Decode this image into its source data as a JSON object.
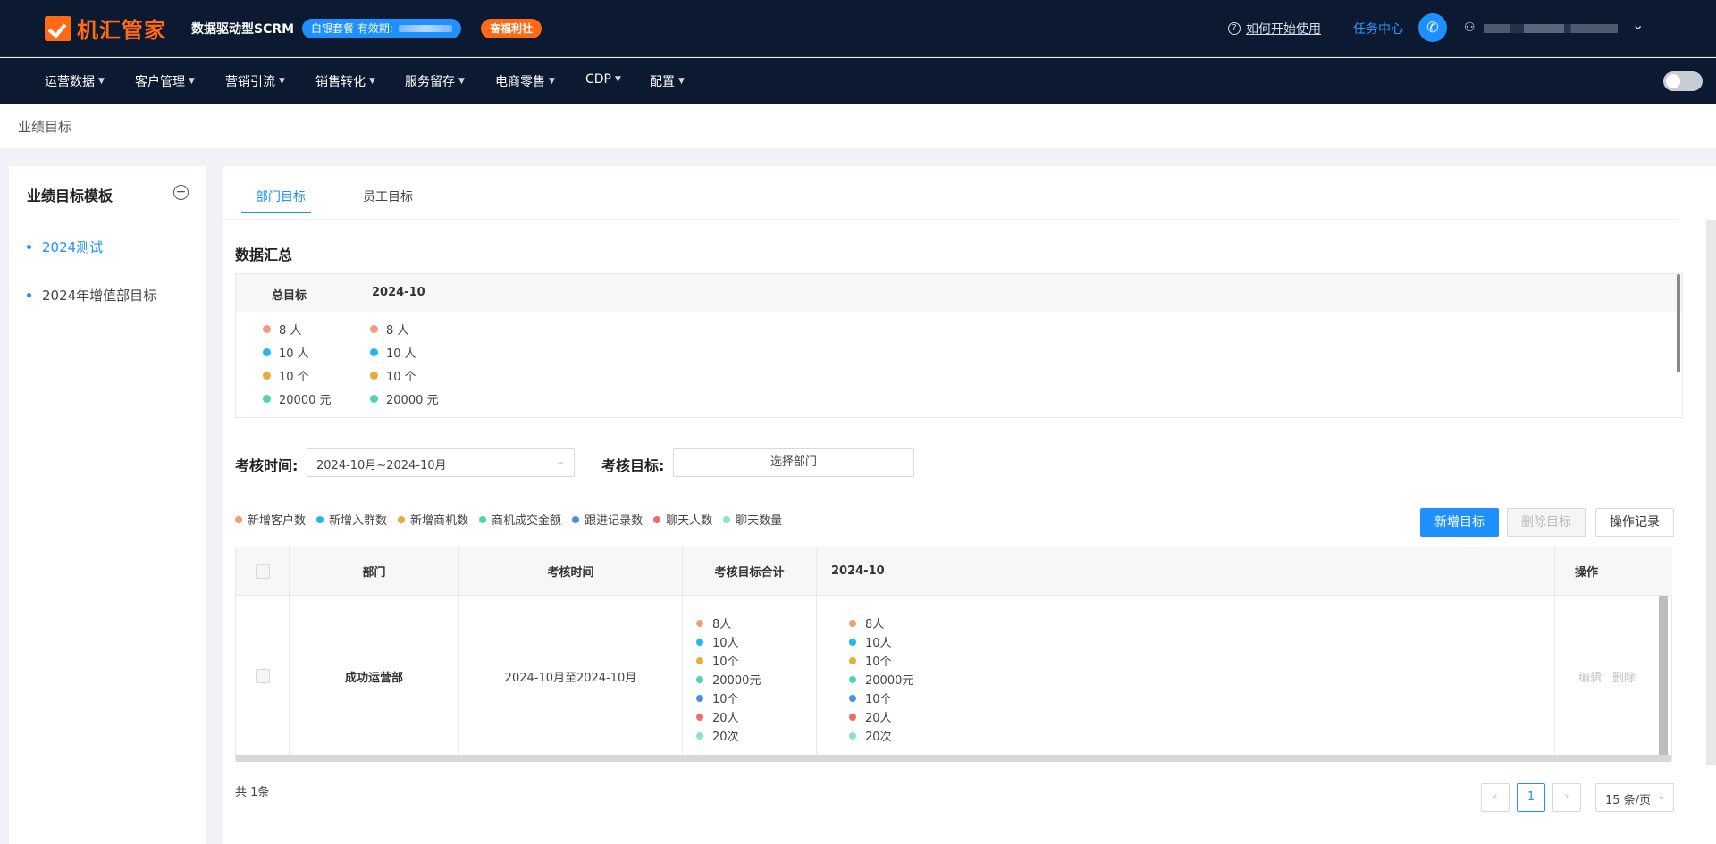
{
  "header": {
    "logo_text": "机汇管家",
    "slogan": "数据驱动型SCRM",
    "package_label": "白银套餐 有效期:",
    "welfare_label": "奋福利社",
    "help_label": "如何开始使用",
    "task_center_label": "任务中心"
  },
  "nav": {
    "items": [
      "运营数据",
      "客户管理",
      "营销引流",
      "销售转化",
      "服务留存",
      "电商零售",
      "CDP",
      "配置"
    ]
  },
  "breadcrumb": {
    "current": "业绩目标"
  },
  "sidebar": {
    "title": "业绩目标模板",
    "items": [
      {
        "label": "2024测试",
        "active": true
      },
      {
        "label": "2024年增值部目标",
        "active": false
      }
    ]
  },
  "tabs": [
    {
      "label": "部门目标",
      "active": true
    },
    {
      "label": "员工目标",
      "active": false
    }
  ],
  "summary": {
    "title": "数据汇总",
    "col1_header": "总目标",
    "col2_header": "2024-10",
    "rows": [
      {
        "value": "8 人",
        "color": "#f59a7a"
      },
      {
        "value": "10 人",
        "color": "#1fb8f0"
      },
      {
        "value": "10 个",
        "color": "#e8ac3b"
      },
      {
        "value": "20000 元",
        "color": "#4fd6a8"
      }
    ]
  },
  "filters": {
    "time_label": "考核时间:",
    "time_value": "2024-10月~2024-10月",
    "target_label": "考核目标:",
    "target_placeholder": "选择部门"
  },
  "legend": [
    {
      "label": "新增客户数",
      "color": "#f59a7a"
    },
    {
      "label": "新增入群数",
      "color": "#1fb8f0"
    },
    {
      "label": "新增商机数",
      "color": "#e8ac3b"
    },
    {
      "label": "商机成交金额",
      "color": "#4fd6a8"
    },
    {
      "label": "跟进记录数",
      "color": "#4a90e2"
    },
    {
      "label": "聊天人数",
      "color": "#ef6b6b"
    },
    {
      "label": "聊天数量",
      "color": "#8ce0cc"
    }
  ],
  "buttons": {
    "add": "新增目标",
    "delete": "删除目标",
    "log": "操作记录"
  },
  "table": {
    "headers": {
      "dept": "部门",
      "time": "考核时间",
      "total": "考核目标合计",
      "month": "2024-10",
      "ops": "操作"
    },
    "rows": [
      {
        "dept": "成功运营部",
        "time": "2024-10月至2024-10月",
        "total": [
          {
            "value": "8人",
            "color": "#f59a7a"
          },
          {
            "value": "10人",
            "color": "#1fb8f0"
          },
          {
            "value": "10个",
            "color": "#e8ac3b"
          },
          {
            "value": "20000元",
            "color": "#4fd6a8"
          },
          {
            "value": "10个",
            "color": "#4a90e2"
          },
          {
            "value": "20人",
            "color": "#ef6b6b"
          },
          {
            "value": "20次",
            "color": "#8ce0cc"
          }
        ],
        "month": [
          {
            "value": "8人",
            "color": "#f59a7a"
          },
          {
            "value": "10人",
            "color": "#1fb8f0"
          },
          {
            "value": "10个",
            "color": "#e8ac3b"
          },
          {
            "value": "20000元",
            "color": "#4fd6a8"
          },
          {
            "value": "10个",
            "color": "#4a90e2"
          },
          {
            "value": "20人",
            "color": "#ef6b6b"
          },
          {
            "value": "20次",
            "color": "#8ce0cc"
          }
        ],
        "edit": "编辑",
        "delete": "删除"
      }
    ]
  },
  "pagination": {
    "total": "共 1条",
    "current_page": "1",
    "page_size": "15 条/页"
  }
}
